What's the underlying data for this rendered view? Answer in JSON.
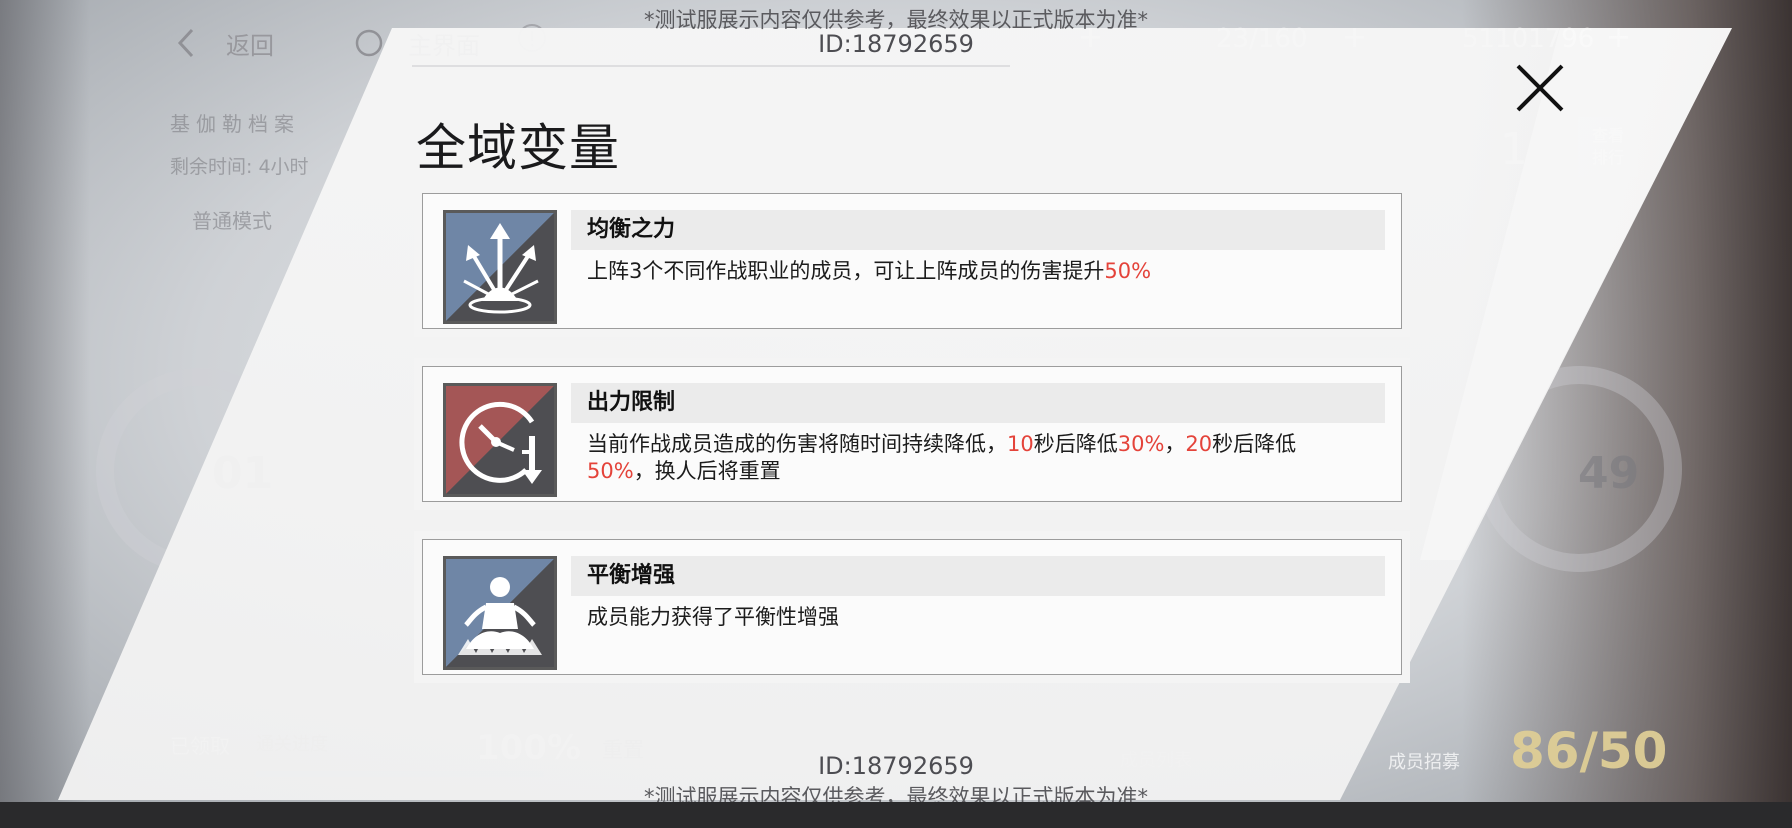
{
  "watermark": {
    "notice": "*测试服展示内容仅供参考，最终效果以正式版本为准*",
    "id_text": "ID:18792659"
  },
  "topbar": {
    "back_label": "返回",
    "home_label": "主界面",
    "stamina": "23/160",
    "currency": "51101796",
    "plus": "+"
  },
  "background": {
    "archive_title": "基伽勒档案",
    "remaining_time": "剩余时间: 4小时",
    "mode": "普通模式",
    "claimed": "已领取",
    "progress_label": "通关进度",
    "progress_value": "100%",
    "reset": "重置",
    "member_list": "成员列表",
    "recruit": "成员招募",
    "recruit_count": "86/50",
    "rank_value": "1",
    "rank_button": "查看\n排行",
    "stage_left": "01",
    "stage_right": "49"
  },
  "modal": {
    "title": "全域变量",
    "cards": [
      {
        "name": "均衡之力",
        "icon": "upward-arrows-burst-icon",
        "desc_parts": [
          {
            "text": "上阵3个不同作战职业的成员，可让上阵成员的伤害提升",
            "red": false
          },
          {
            "text": "50%",
            "red": true
          }
        ]
      },
      {
        "name": "出力限制",
        "icon": "clock-down-arrow-icon",
        "desc_parts": [
          {
            "text": "当前作战成员造成的伤害将随时间持续降低，",
            "red": false
          },
          {
            "text": "10",
            "red": true
          },
          {
            "text": "秒后降低",
            "red": false
          },
          {
            "text": "30%",
            "red": true
          },
          {
            "text": "，",
            "red": false
          },
          {
            "text": "20",
            "red": true
          },
          {
            "text": "秒后降低",
            "red": false
          },
          {
            "text": "50%",
            "red": true
          },
          {
            "text": "，换人后将重置",
            "red": false
          }
        ]
      },
      {
        "name": "平衡增强",
        "icon": "meditating-figure-icon",
        "desc_parts": [
          {
            "text": "成员能力获得了平衡性增强",
            "red": false
          }
        ]
      }
    ]
  },
  "colors": {
    "highlight": "#e4433a",
    "icon_blue": "#6f86a6",
    "icon_red": "#a45656"
  }
}
